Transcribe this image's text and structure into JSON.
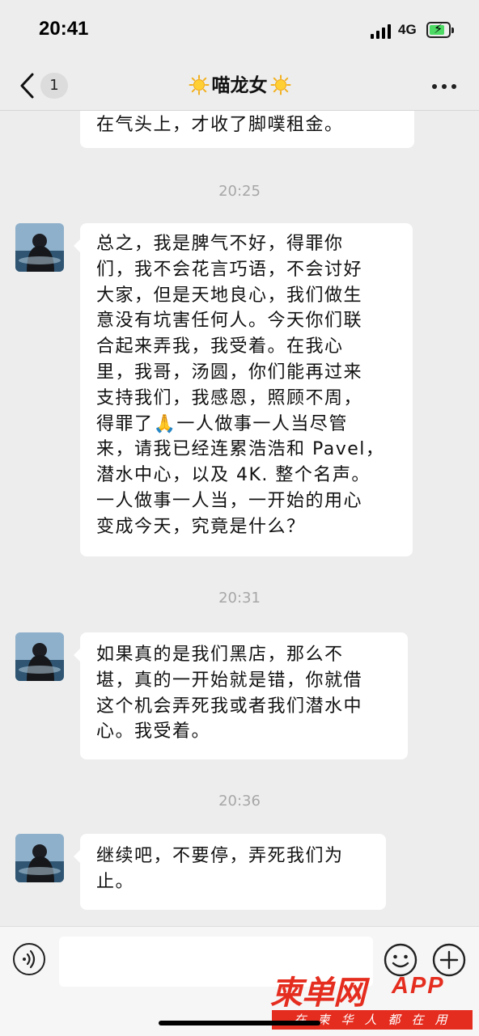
{
  "status_bar": {
    "time": "20:41",
    "network": "4G"
  },
  "nav": {
    "unread_count": "1",
    "title": "喵龙女",
    "title_icon": "sun-emoji-icon"
  },
  "messages": [
    {
      "type": "text",
      "incoming": true,
      "lines": [
        "在气头上，才收了脚噗租金。"
      ]
    },
    {
      "type": "timestamp",
      "text": "20:25"
    },
    {
      "type": "text",
      "incoming": true,
      "lines": [
        "总之，我是脾气不好，得罪你",
        "们，我不会花言巧语，不会讨好",
        "大家，但是天地良心，我们做生",
        "意没有坑害任何人。今天你们联",
        "合起来弄我，我受着。在我心",
        "里，我哥，汤圆，你们能再过来",
        "支持我们，我感恩，照顾不周，",
        "得罪了🙏一人做事一人当尽管",
        "来，请我已经连累浩浩和 Pavel，",
        "潜水中心，以及 4K. 整个名声。",
        "一人做事一人当，一开始的用心",
        "变成今天，究竟是什么？"
      ]
    },
    {
      "type": "timestamp",
      "text": "20:31"
    },
    {
      "type": "text",
      "incoming": true,
      "lines": [
        "如果真的是我们黑店，那么不",
        "堪，真的一开始就是错，你就借",
        "这个机会弄死我或者我们潜水中",
        "心。我受着。"
      ]
    },
    {
      "type": "timestamp",
      "text": "20:36"
    },
    {
      "type": "text",
      "incoming": true,
      "lines": [
        "继续吧，不要停，弄死我们为",
        "止。"
      ]
    }
  ],
  "input_bar": {
    "voice_icon": "voice-icon",
    "emoji_icon": "emoji-icon",
    "plus_icon": "plus-icon",
    "placeholder": ""
  },
  "watermark": {
    "logo": "柬单网",
    "app": "APP",
    "slogan": "在柬华人都在用"
  },
  "colors": {
    "background": "#ededed",
    "bubble": "#ffffff",
    "timestamp": "#a7a7a7",
    "watermark_red": "#e52d1f"
  }
}
